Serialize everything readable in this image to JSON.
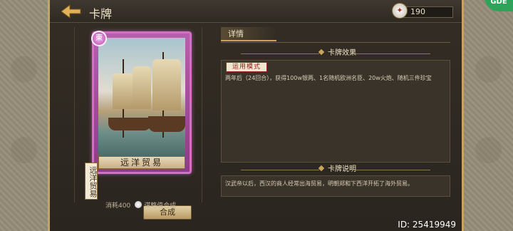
{
  "header": {
    "title": "卡牌",
    "currency_value": "190"
  },
  "card": {
    "badge": "東",
    "name": "远洋贸易",
    "vertical_label": "远洋贸易",
    "combine_label": "合成",
    "cost_label": "消耗400",
    "cost_suffix": "谋略值合成"
  },
  "detail": {
    "tab_label": "详情",
    "effect_header": "卡牌效果",
    "mode_tag": "运用模式",
    "effect_text": "两年后（24回合），获得100w银两、1名随机欧洲名臣、20w火炮、随机三件珍宝",
    "desc_header": "卡牌说明",
    "desc_text": "汉武帝以后，西汉的商人经常出海贸易，明朝郑和下西洋开拓了海外贸易。"
  },
  "footer": {
    "id_text": "ID: 25419949"
  },
  "corner_badge": "GDE",
  "colors": {
    "gold_accent": "#c9a45a",
    "card_frame_purple": "#d46fc6",
    "mode_tag_red": "#8e1e18"
  },
  "icons": [
    "back-arrow-icon",
    "currency-icon",
    "cost-icon"
  ]
}
